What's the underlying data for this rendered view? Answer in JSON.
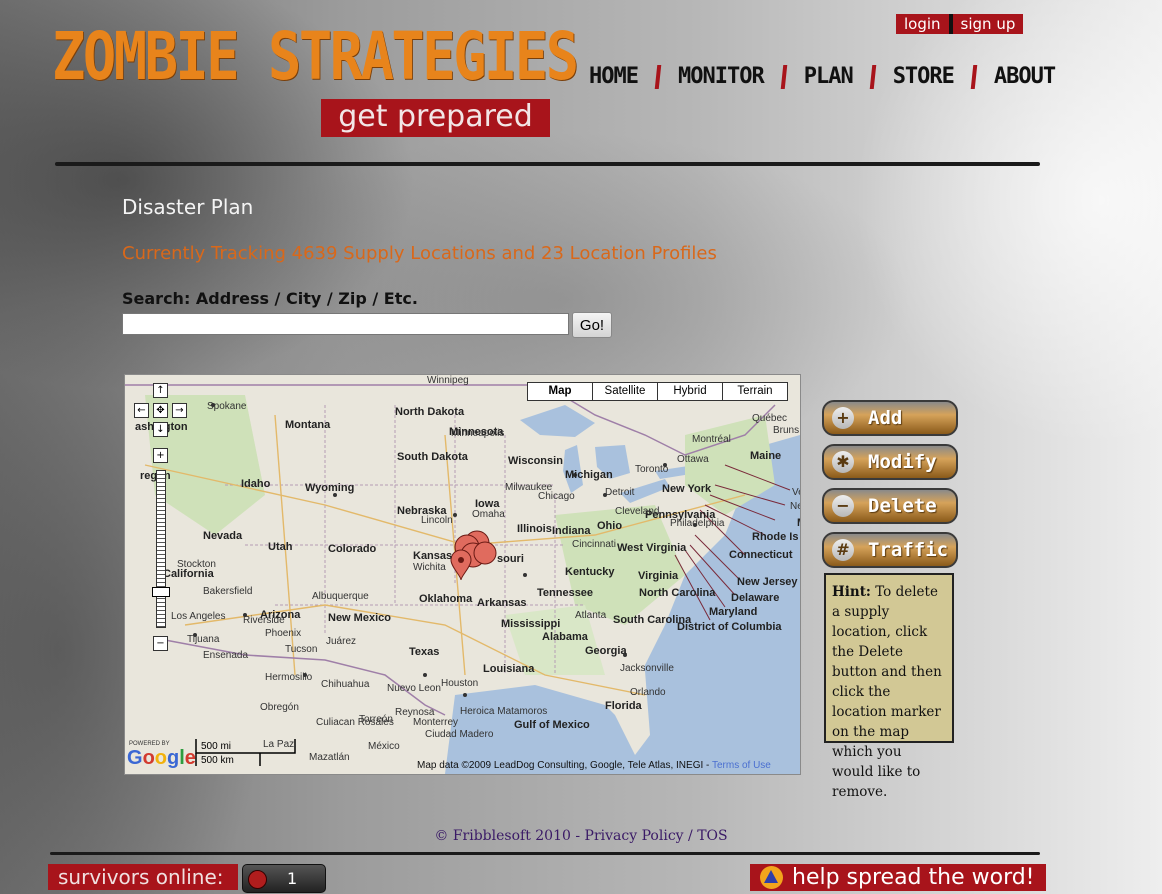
{
  "header": {
    "brand": "ZOMBIE STRATEGIES",
    "tagline": "get prepared",
    "auth": {
      "login": "login",
      "signup": "sign up"
    },
    "nav": [
      "HOME",
      "MONITOR",
      "PLAN",
      "STORE",
      "ABOUT"
    ]
  },
  "main": {
    "title": "Disaster Plan",
    "tracking": "Currently Tracking 4639 Supply Locations and 23 Location Profiles",
    "search": {
      "label": "Search: Address / City / Zip / Etc.",
      "value": "",
      "button": "Go!"
    }
  },
  "map": {
    "types": [
      "Map",
      "Satellite",
      "Hybrid",
      "Terrain"
    ],
    "selected_type": "Map",
    "labels": [
      "Winnipeg",
      "Spokane",
      "North Dakota",
      "Minnesota",
      "Québec",
      "Montana",
      "ashington",
      "Minneapolis",
      "Montréal",
      "Bruns",
      "South Dakota",
      "Wisconsin",
      "Ottawa",
      "Maine",
      "regon",
      "Michigan",
      "Toronto",
      "Idaho",
      "Wyoming",
      "Milwaukee",
      "Chicago",
      "Detroit",
      "New York",
      "Iowa",
      "Omaha",
      "Nebraska",
      "Pennsylvania",
      "Lincoln",
      "Illinois",
      "Indiana",
      "Ohio",
      "Cleveland",
      "Philadelphia",
      "Nevada",
      "Utah",
      "Colorado",
      "Kansas",
      "souri",
      "Cincinnati",
      "Wichita",
      "West Virginia",
      "California",
      "Stockton",
      "Kentucky",
      "Virginia",
      "Bakersfield",
      "Oklahoma",
      "Arkansas",
      "Tennessee",
      "North Carolina",
      "Albuquerque",
      "Arizona",
      "Los Angeles",
      "Riverside",
      "Phoenix",
      "Tijuana",
      "Ensenada",
      "Tucson",
      "New Mexico",
      "Juárez",
      "Mississippi",
      "Alabama",
      "South Carolina",
      "Atlanta",
      "Georgia",
      "Texas",
      "Louisiana",
      "Hermosillo",
      "Chihuahua",
      "Jacksonville",
      "Orlando",
      "Houston",
      "Nuevo Leon",
      "Heroica Matamoros",
      "Florida",
      "Gulf of Mexico",
      "Culiacan Rosales",
      "Torreón",
      "Reynosa",
      "Monterrey",
      "Ciudad Madero",
      "México",
      "Mazatlán",
      "La Paz",
      "Obregón",
      "Massa",
      "Rhode Is",
      "Connecticut",
      "New Jersey",
      "Delaware",
      "Maryland",
      "District of Columbia",
      "Ne",
      "Ve"
    ],
    "scale": {
      "miles": "500 mi",
      "km": "500 km"
    },
    "powered_by": "POWERED BY",
    "logo": "Google",
    "attribution": "Map data ©2009 LeadDog Consulting, Google, Tele Atlas, INEGI - ",
    "terms": "Terms of Use"
  },
  "actions": [
    {
      "label": "Add",
      "icon": "+"
    },
    {
      "label": "Modify",
      "icon": "✱"
    },
    {
      "label": "Delete",
      "icon": "−"
    },
    {
      "label": "Traffic",
      "icon": "#"
    }
  ],
  "hint": {
    "label": "Hint:",
    "text": "To delete a supply location, click the Delete button and then click the location marker on the map which you would like to remove."
  },
  "footer": {
    "copyright": "© Fribblesoft 2010 - ",
    "privacy": "Privacy Policy",
    "sep": " / ",
    "tos": "TOS"
  },
  "bottom": {
    "survivors_label": "survivors online:",
    "survivors_count": "1",
    "spread": "help spread the word!"
  },
  "colors": {
    "brand_orange": "#e8841b",
    "brand_red": "#a8141b",
    "tracking_orange": "#d9681a",
    "hint_bg": "#d2c895"
  }
}
